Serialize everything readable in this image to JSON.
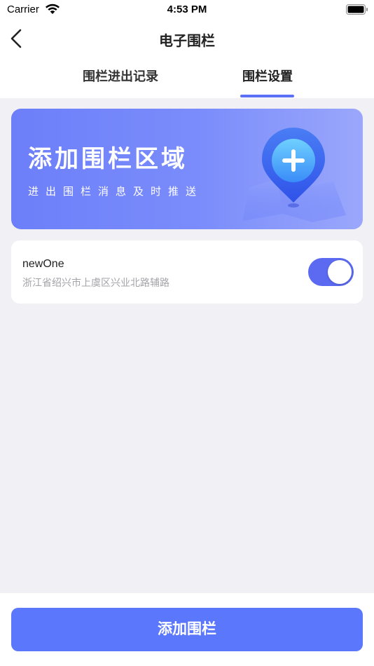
{
  "status_bar": {
    "carrier": "Carrier",
    "time": "4:53 PM"
  },
  "nav": {
    "title": "电子围栏"
  },
  "tabs": [
    {
      "label": "围栏进出记录",
      "active": false
    },
    {
      "label": "围栏设置",
      "active": true
    }
  ],
  "banner": {
    "title": "添加围栏区域",
    "subtitle": "进出围栏消息及时推送"
  },
  "fences": [
    {
      "name": "newOne",
      "address": "浙江省绍兴市上虞区兴业北路辅路",
      "enabled": true
    }
  ],
  "footer": {
    "add_label": "添加围栏"
  },
  "colors": {
    "accent": "#5b77fb",
    "toggle_on": "#5b6af0",
    "background": "#f1f0f5"
  },
  "icons": [
    "wifi-icon",
    "battery-icon",
    "back-arrow-icon",
    "location-pin-plus-icon"
  ]
}
